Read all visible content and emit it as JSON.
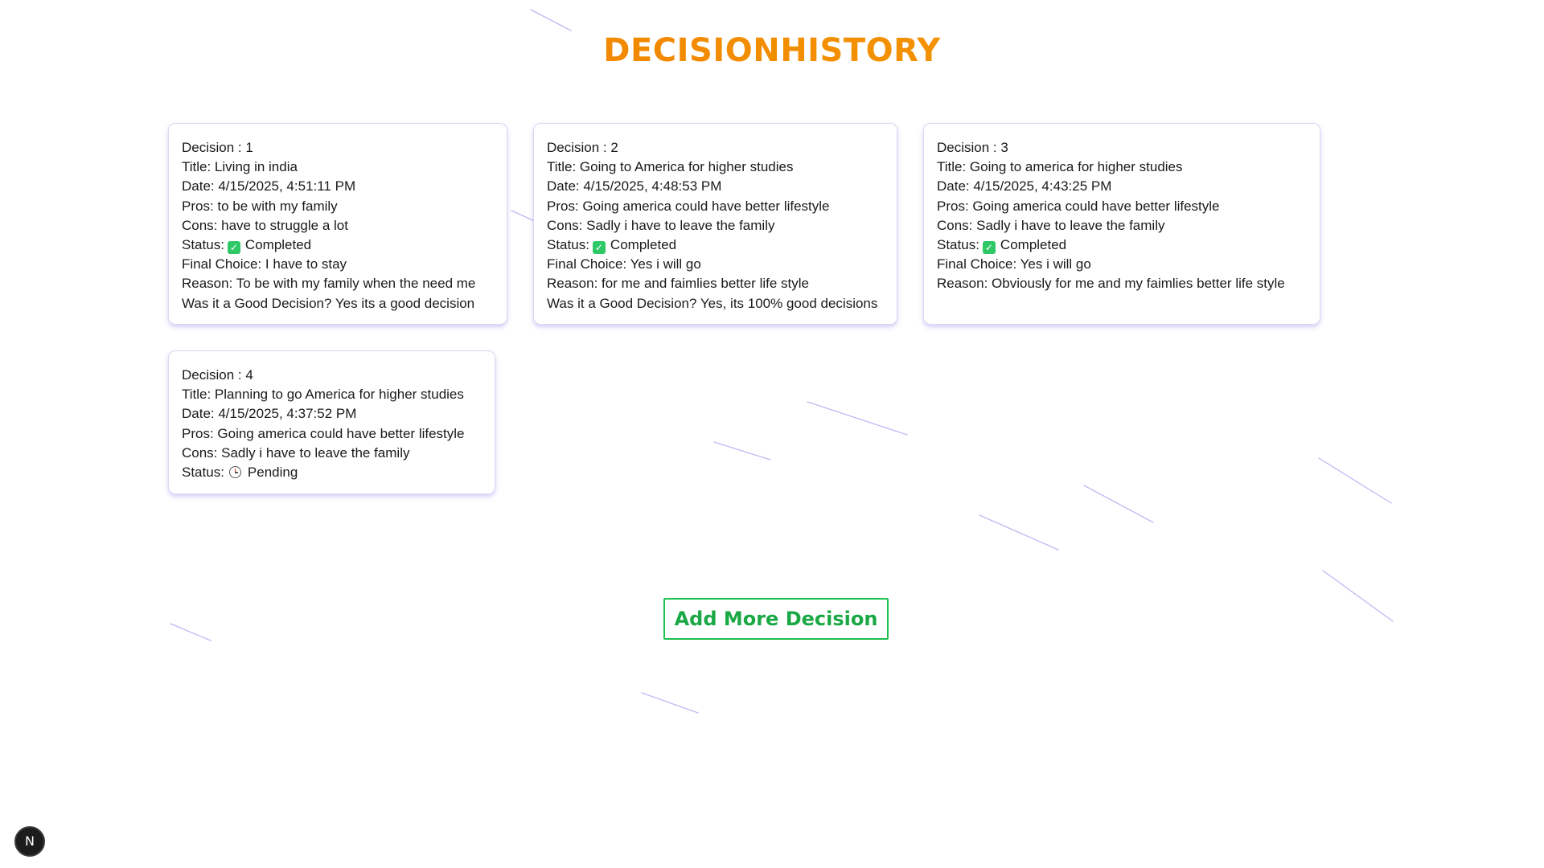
{
  "page": {
    "title": "DECISIONHISTORY"
  },
  "colors": {
    "title_gradient_start": "#f07a00",
    "title_gradient_end": "#f5a000",
    "button_green": "#1dbf4e",
    "card_shadow": "#8278e6",
    "status_check": "#2ec866"
  },
  "cards": [
    {
      "decision": "Decision : 1",
      "title": "Title: Living in india",
      "date": "Date: 4/15/2025, 4:51:11 PM",
      "pros": "Pros: to be with my family",
      "cons": "Cons: have to struggle a lot",
      "status_label": "Status:",
      "status_icon": "check-icon",
      "status_value": "Completed",
      "final_choice": "Final Choice: I have to stay",
      "reason": "Reason: To be with my family when the need me",
      "good_decision": "Was it a Good Decision? Yes its a good decision"
    },
    {
      "decision": "Decision : 2",
      "title": "Title: Going to America for higher studies",
      "date": "Date: 4/15/2025, 4:48:53 PM",
      "pros": "Pros: Going america could have better lifestyle",
      "cons": "Cons: Sadly i have to leave the family",
      "status_label": "Status:",
      "status_icon": "check-icon",
      "status_value": "Completed",
      "final_choice": "Final Choice: Yes i will go",
      "reason": "Reason: for me and faimlies better life style",
      "good_decision": "Was it a Good Decision? Yes, its 100% good decisions"
    },
    {
      "decision": "Decision : 3",
      "title": "Title: Going to america for higher studies",
      "date": "Date: 4/15/2025, 4:43:25 PM",
      "pros": "Pros: Going america could have better lifestyle",
      "cons": "Cons: Sadly i have to leave the family",
      "status_label": "Status:",
      "status_icon": "check-icon",
      "status_value": "Completed",
      "final_choice": "Final Choice: Yes i will go",
      "reason": "Reason: Obviously for me and my faimlies better life style"
    },
    {
      "decision": "Decision : 4",
      "title": "Title: Planning to go America for higher studies",
      "date": "Date: 4/15/2025, 4:37:52 PM",
      "pros": "Pros: Going america could have better lifestyle",
      "cons": "Cons: Sadly i have to leave the family",
      "status_label": "Status:",
      "status_icon": "clock-icon",
      "status_value": "Pending"
    }
  ],
  "actions": {
    "add_more_label": "Add More Decision"
  },
  "dev_badge": {
    "letter": "N",
    "icon": "nextjs-logo-icon"
  }
}
